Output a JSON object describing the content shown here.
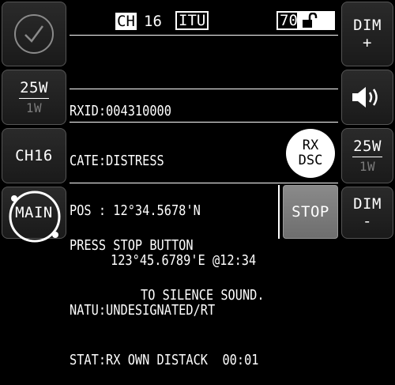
{
  "header": {
    "channel_prefix": "CH",
    "channel_number": "16",
    "channel_mode": "ITU",
    "memory_channel": "70"
  },
  "left_panel": {
    "power_high": "25W",
    "power_low": "1W",
    "channel_button": "CH16",
    "main_button": "MAIN"
  },
  "right_panel": {
    "dim_up_top": "DIM",
    "dim_up_symbol": "+",
    "power_high": "25W",
    "power_low": "1W",
    "dim_down_top": "DIM",
    "dim_down_symbol": "-"
  },
  "info": {
    "rxid": "RXID:004310000",
    "cate": "CATE:DISTRESS",
    "pos_lat": "POS : 12°34.5678'N",
    "pos_lon": "123°45.6789'E @12:34",
    "natu": "NATU:UNDESIGNATED/RT",
    "stat": "STAT:RX OWN DISTACK  00:01"
  },
  "rx_dsc": {
    "line1": "RX",
    "line2": "DSC"
  },
  "message": {
    "line1": "PRESS STOP BUTTON",
    "line2": "TO SILENCE SOUND."
  },
  "stop_button": "STOP",
  "colors": {
    "background": "#000000",
    "stop_button": "#7d7d7d",
    "text": "#ffffff",
    "dimmed": "#7a7a7a"
  },
  "icons": [
    "checkmark-icon",
    "unlock-icon",
    "speaker-icon",
    "main-dial-icon"
  ]
}
